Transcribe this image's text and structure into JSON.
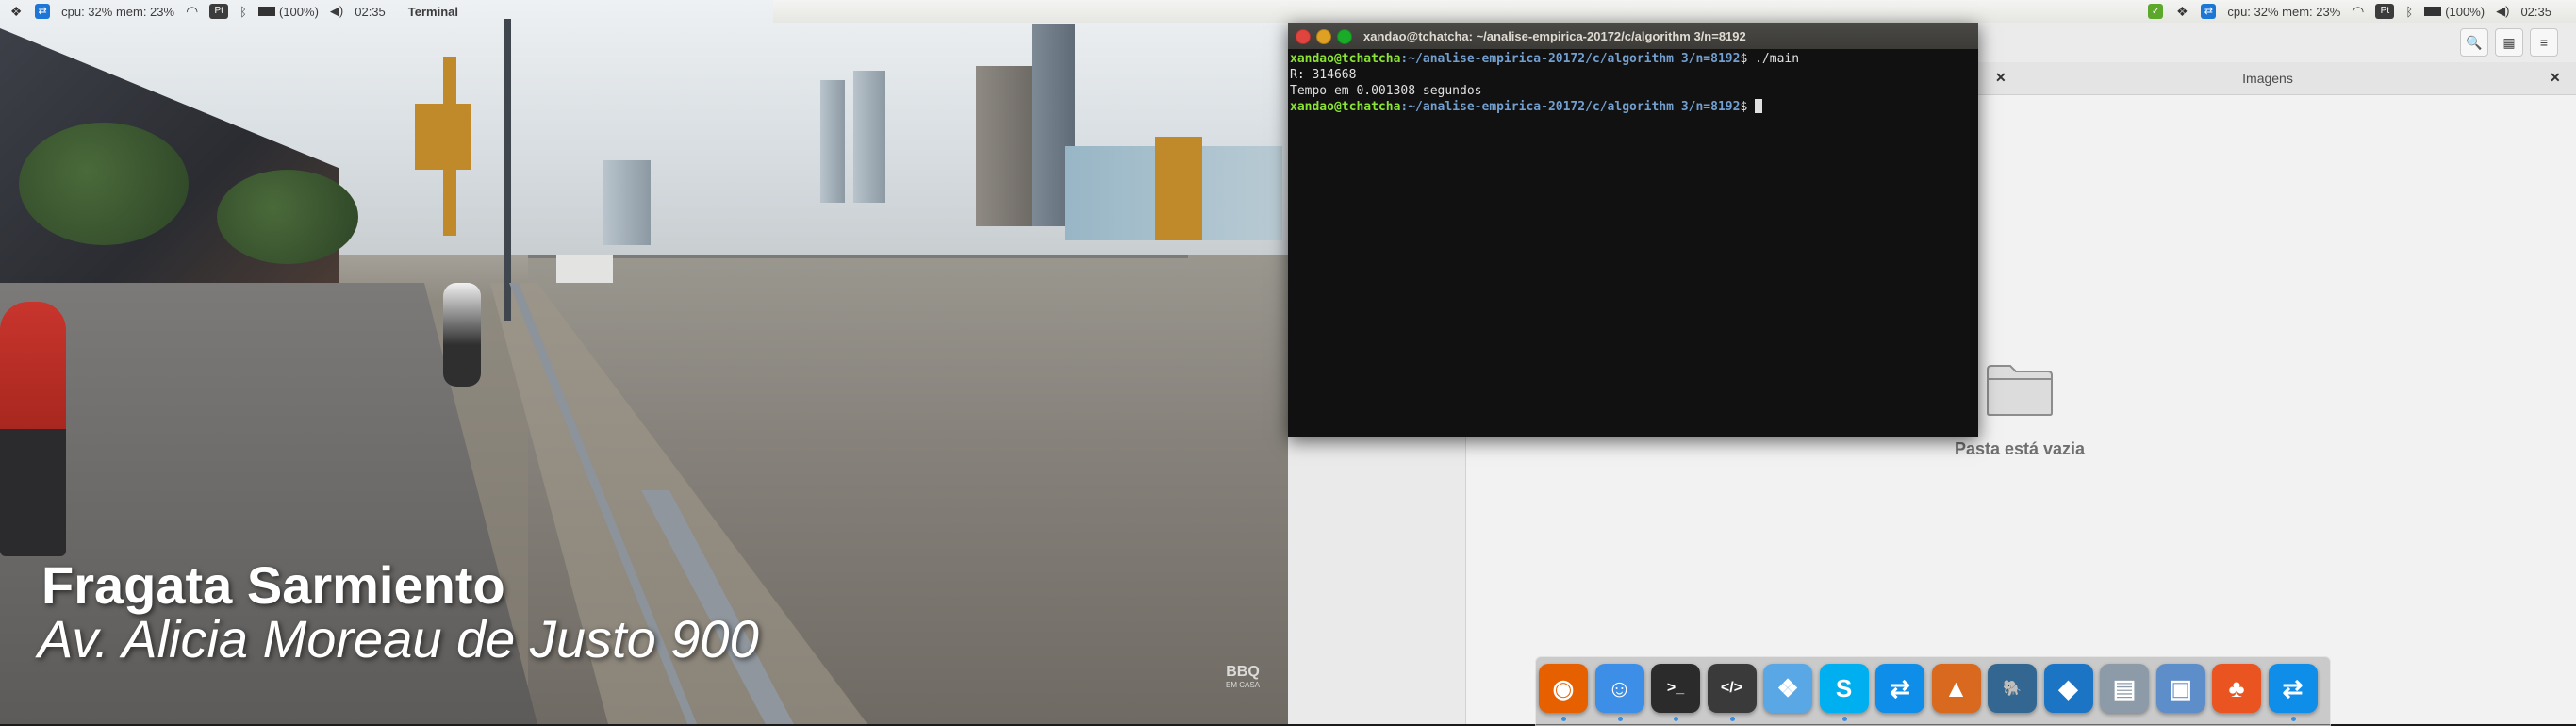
{
  "left_panel": {
    "cpu_mem": "cpu: 32% mem: 23%",
    "keyboard": "Pt",
    "battery": "(100%)",
    "time": "02:35",
    "app_menu": "Terminal"
  },
  "right_panel": {
    "cpu_mem": "cpu: 32% mem: 23%",
    "keyboard": "Pt",
    "battery": "(100%)",
    "time": "02:35"
  },
  "video": {
    "caption_title": "Fragata Sarmiento",
    "caption_subtitle": "Av. Alicia Moreau de Justo 900",
    "watermark": "BBQ",
    "watermark_small": "EM CASA"
  },
  "terminal": {
    "title": "xandao@tchatcha: ~/analise-empirica-20172/c/algorithm 3/n=8192",
    "user_host": "xandao@tchatcha",
    "path": ":~/analise-empirica-20172/c/algorithm 3/n=8192",
    "prompt_suffix": "$ ",
    "command": "./main",
    "output_1": "R: 314668",
    "output_2": "Tempo em 0.001308 segundos"
  },
  "file_manager": {
    "tab_label": "Imagens",
    "empty_message": "Pasta está vazia"
  },
  "dock": {
    "items": [
      {
        "name": "firefox",
        "glyph": "◉",
        "color": "#e66000"
      },
      {
        "name": "finder",
        "glyph": "☺",
        "color": "#3d8ee6"
      },
      {
        "name": "terminal",
        "glyph": ">_",
        "color": "#2b2b2b"
      },
      {
        "name": "code-editor",
        "glyph": "</>",
        "color": "#3a3a3a"
      },
      {
        "name": "dropbox",
        "glyph": "❖",
        "color": "#5aa7e6"
      },
      {
        "name": "skype",
        "glyph": "S",
        "color": "#00aff0"
      },
      {
        "name": "teamviewer",
        "glyph": "⇄",
        "color": "#0e8ee9"
      },
      {
        "name": "matlab",
        "glyph": "▲",
        "color": "#d9691e"
      },
      {
        "name": "postgresql",
        "glyph": "🐘",
        "color": "#336791"
      },
      {
        "name": "mysql-workbench",
        "glyph": "◆",
        "color": "#1c74c4"
      },
      {
        "name": "scanner",
        "glyph": "▤",
        "color": "#8d9aa8"
      },
      {
        "name": "virtualbox",
        "glyph": "▣",
        "color": "#5e8ec9"
      },
      {
        "name": "ubuntu-software",
        "glyph": "♣",
        "color": "#e95420"
      },
      {
        "name": "teamviewer-2",
        "glyph": "⇄",
        "color": "#0e8ee9"
      }
    ]
  }
}
